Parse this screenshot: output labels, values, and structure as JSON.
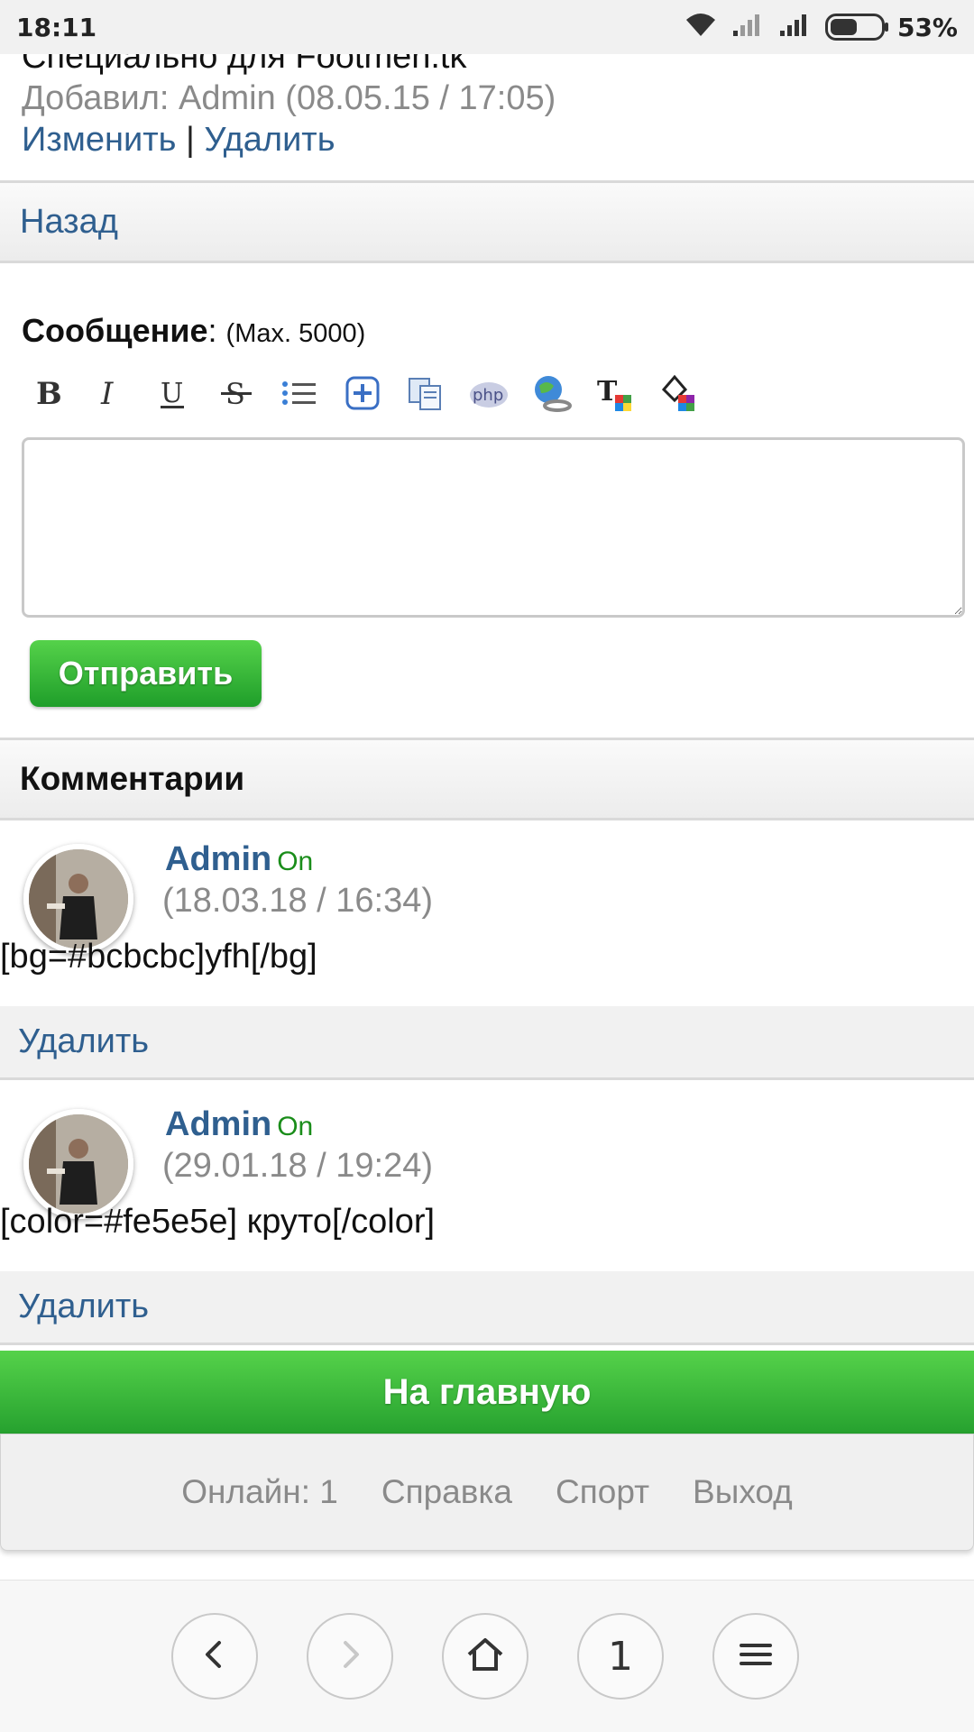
{
  "status_bar": {
    "time": "18:11",
    "battery": "53%",
    "battery_level": 0.53
  },
  "post": {
    "title": "Специально для Footmen.tk",
    "added_by": "Добавил: Admin (08.05.15 / 17:05)",
    "edit_link": "Изменить",
    "separator": "|",
    "delete_link": "Удалить"
  },
  "back_link": "Назад",
  "form": {
    "label": "Сообщение",
    "colon": ":",
    "max_hint": "(Max. 5000)",
    "toolbar_icons": [
      "bold-icon",
      "italic-icon",
      "underline-icon",
      "strikethrough-icon",
      "list-icon",
      "spoiler-icon",
      "copy-icon",
      "php-icon",
      "link-icon",
      "text-color-icon",
      "background-color-icon"
    ],
    "message_value": "",
    "send_button": "Отправить"
  },
  "comments_header": "Комментарии",
  "comments": [
    {
      "author": "Admin",
      "status": "On",
      "date": "(18.03.18 / 16:34)",
      "text": "[bg=#bcbcbc]yfh[/bg]",
      "delete": "Удалить"
    },
    {
      "author": "Admin",
      "status": "On",
      "date": "(29.01.18 / 19:24)",
      "text": "[color=#fe5e5e] круто[/color]",
      "delete": "Удалить"
    }
  ],
  "home_button": "На главную",
  "footer_links": [
    "Онлайн: 1",
    "Справка",
    "Спорт",
    "Выход"
  ],
  "browser_nav": {
    "tab_count": "1"
  },
  "colors": {
    "accent_green": "#3cba3c",
    "link_blue": "#2f5f8f",
    "online_green": "#1a8d1a"
  }
}
